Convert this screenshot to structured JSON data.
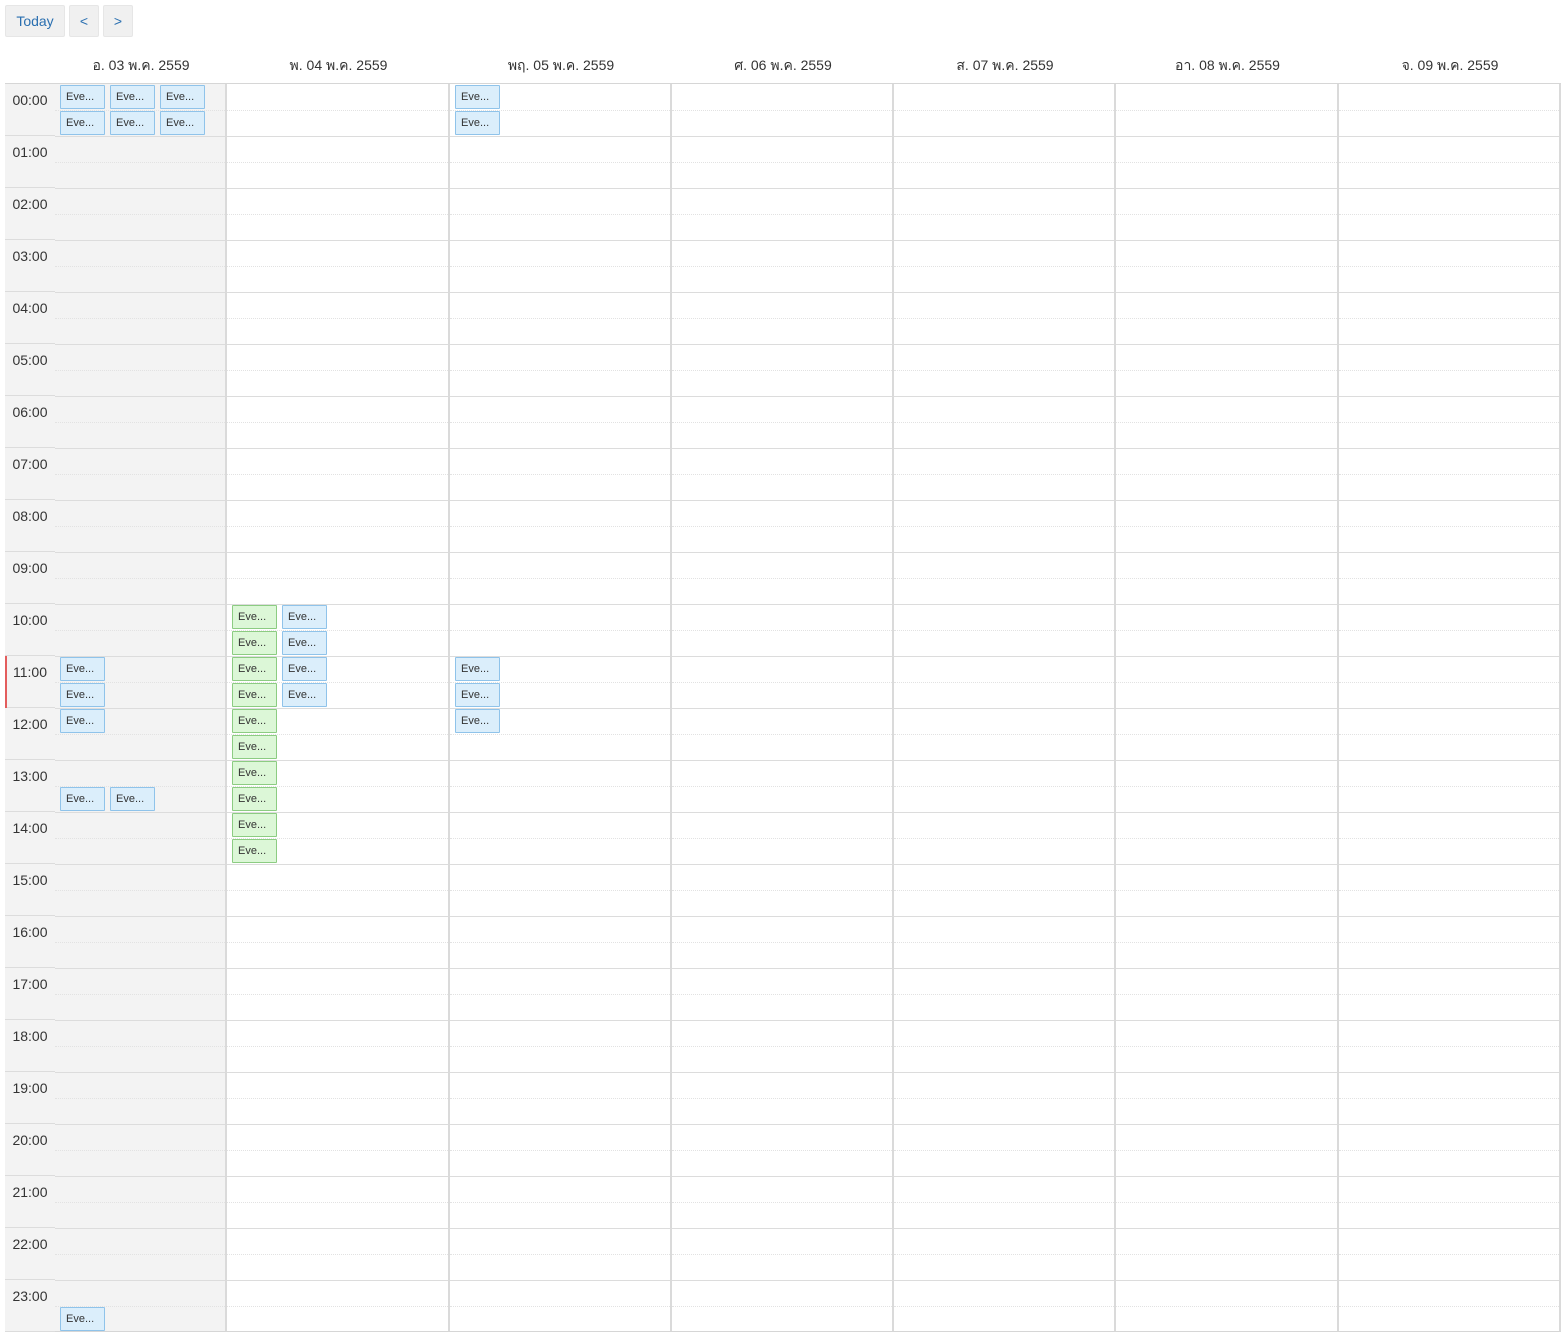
{
  "toolbar": {
    "today_label": "Today",
    "prev_label": "<",
    "next_label": ">",
    "accent_color": "#2a6fb0"
  },
  "days": [
    {
      "label": "อ. 03 พ.ค. 2559",
      "is_today": true
    },
    {
      "label": "พ. 04 พ.ค. 2559",
      "is_today": false
    },
    {
      "label": "พฤ. 05 พ.ค. 2559",
      "is_today": false
    },
    {
      "label": "ศ. 06 พ.ค. 2559",
      "is_today": false
    },
    {
      "label": "ส. 07 พ.ค. 2559",
      "is_today": false
    },
    {
      "label": "อา. 08 พ.ค. 2559",
      "is_today": false
    },
    {
      "label": "จ. 09 พ.ค. 2559",
      "is_today": false
    }
  ],
  "hours": [
    "00:00",
    "01:00",
    "02:00",
    "03:00",
    "04:00",
    "05:00",
    "06:00",
    "07:00",
    "08:00",
    "09:00",
    "10:00",
    "11:00",
    "12:00",
    "13:00",
    "14:00",
    "15:00",
    "16:00",
    "17:00",
    "18:00",
    "19:00",
    "20:00",
    "21:00",
    "22:00",
    "23:00"
  ],
  "current_time": "11:00",
  "colors": {
    "event_blue": "#dbeefb",
    "event_green": "#dcf7d7",
    "now_line": "#e35d5d",
    "today_bg": "#f3f3f3"
  },
  "events": [
    {
      "day": 0,
      "start": "00:00",
      "column": 0,
      "color": "blue",
      "title": "Eve..."
    },
    {
      "day": 0,
      "start": "00:00",
      "column": 1,
      "color": "blue",
      "title": "Eve..."
    },
    {
      "day": 0,
      "start": "00:00",
      "column": 2,
      "color": "blue",
      "title": "Eve..."
    },
    {
      "day": 0,
      "start": "00:30",
      "column": 0,
      "color": "blue",
      "title": "Eve..."
    },
    {
      "day": 0,
      "start": "00:30",
      "column": 1,
      "color": "blue",
      "title": "Eve..."
    },
    {
      "day": 0,
      "start": "00:30",
      "column": 2,
      "color": "blue",
      "title": "Eve..."
    },
    {
      "day": 0,
      "start": "11:00",
      "column": 0,
      "color": "blue",
      "title": "Eve..."
    },
    {
      "day": 0,
      "start": "11:30",
      "column": 0,
      "color": "blue",
      "title": "Eve..."
    },
    {
      "day": 0,
      "start": "12:00",
      "column": 0,
      "color": "blue",
      "title": "Eve..."
    },
    {
      "day": 0,
      "start": "13:30",
      "column": 0,
      "color": "blue",
      "title": "Eve..."
    },
    {
      "day": 0,
      "start": "13:30",
      "column": 1,
      "color": "blue",
      "title": "Eve..."
    },
    {
      "day": 0,
      "start": "23:30",
      "column": 0,
      "color": "blue",
      "title": "Eve..."
    },
    {
      "day": 1,
      "start": "10:00",
      "column": 0,
      "color": "green",
      "title": "Eve..."
    },
    {
      "day": 1,
      "start": "10:30",
      "column": 0,
      "color": "green",
      "title": "Eve..."
    },
    {
      "day": 1,
      "start": "11:00",
      "column": 0,
      "color": "green",
      "title": "Eve..."
    },
    {
      "day": 1,
      "start": "11:30",
      "column": 0,
      "color": "green",
      "title": "Eve..."
    },
    {
      "day": 1,
      "start": "12:00",
      "column": 0,
      "color": "green",
      "title": "Eve..."
    },
    {
      "day": 1,
      "start": "12:30",
      "column": 0,
      "color": "green",
      "title": "Eve..."
    },
    {
      "day": 1,
      "start": "13:00",
      "column": 0,
      "color": "green",
      "title": "Eve..."
    },
    {
      "day": 1,
      "start": "13:30",
      "column": 0,
      "color": "green",
      "title": "Eve..."
    },
    {
      "day": 1,
      "start": "14:00",
      "column": 0,
      "color": "green",
      "title": "Eve..."
    },
    {
      "day": 1,
      "start": "14:30",
      "column": 0,
      "color": "green",
      "title": "Eve..."
    },
    {
      "day": 1,
      "start": "10:00",
      "column": 1,
      "color": "blue",
      "title": "Eve..."
    },
    {
      "day": 1,
      "start": "10:30",
      "column": 1,
      "color": "blue",
      "title": "Eve..."
    },
    {
      "day": 1,
      "start": "11:00",
      "column": 1,
      "color": "blue",
      "title": "Eve..."
    },
    {
      "day": 1,
      "start": "11:30",
      "column": 1,
      "color": "blue",
      "title": "Eve..."
    },
    {
      "day": 2,
      "start": "00:00",
      "column": 0,
      "color": "blue",
      "title": "Eve..."
    },
    {
      "day": 2,
      "start": "00:30",
      "column": 0,
      "color": "blue",
      "title": "Eve..."
    },
    {
      "day": 2,
      "start": "11:00",
      "column": 0,
      "color": "blue",
      "title": "Eve..."
    },
    {
      "day": 2,
      "start": "11:30",
      "column": 0,
      "color": "blue",
      "title": "Eve..."
    },
    {
      "day": 2,
      "start": "12:00",
      "column": 0,
      "color": "blue",
      "title": "Eve..."
    }
  ]
}
